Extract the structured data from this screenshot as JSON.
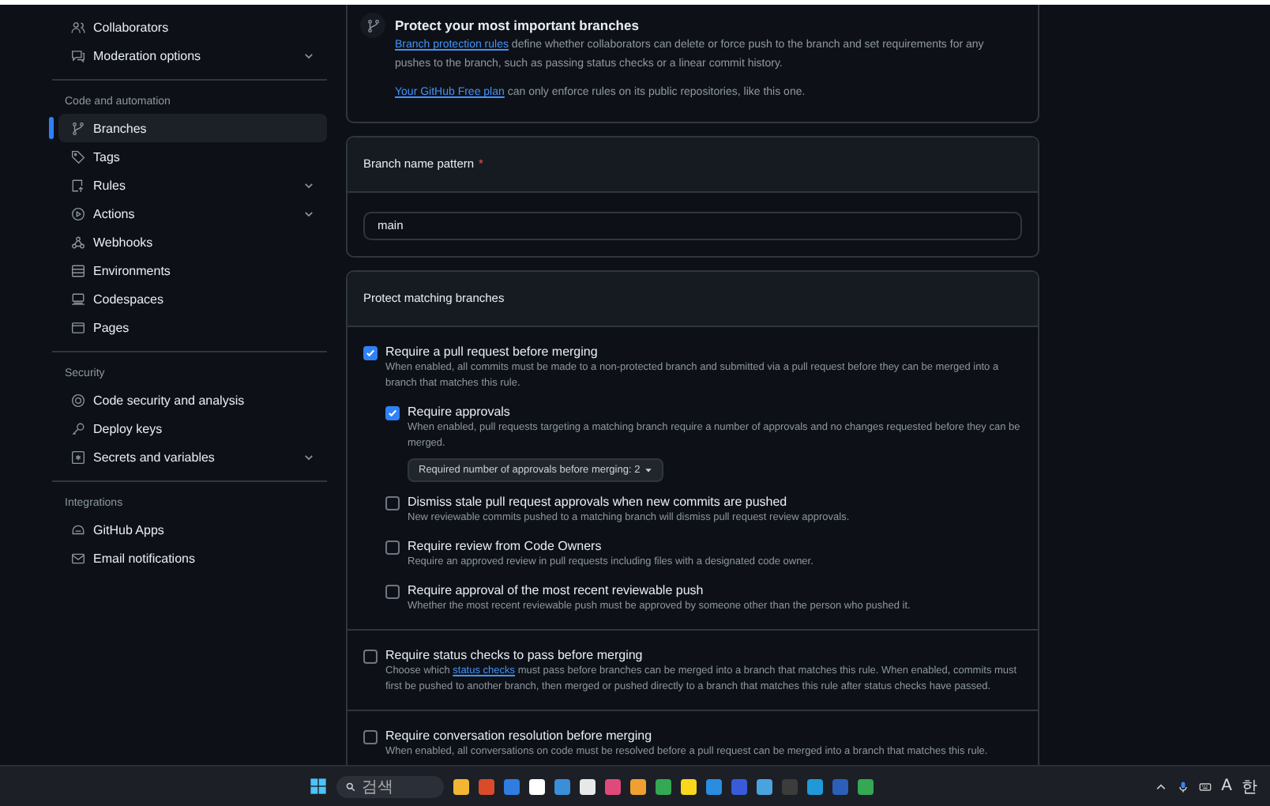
{
  "sidebar": {
    "groups": [
      {
        "items": [
          {
            "label": "Collaborators",
            "selected": false,
            "expandable": false
          },
          {
            "label": "Moderation options",
            "selected": false,
            "expandable": true
          }
        ]
      },
      {
        "heading": "Code and automation",
        "items": [
          {
            "label": "Branches",
            "selected": true,
            "expandable": false
          },
          {
            "label": "Tags",
            "selected": false,
            "expandable": false
          },
          {
            "label": "Rules",
            "selected": false,
            "expandable": true
          },
          {
            "label": "Actions",
            "selected": false,
            "expandable": true
          },
          {
            "label": "Webhooks",
            "selected": false,
            "expandable": false
          },
          {
            "label": "Environments",
            "selected": false,
            "expandable": false
          },
          {
            "label": "Codespaces",
            "selected": false,
            "expandable": false
          },
          {
            "label": "Pages",
            "selected": false,
            "expandable": false
          }
        ]
      },
      {
        "heading": "Security",
        "items": [
          {
            "label": "Code security and analysis",
            "selected": false,
            "expandable": false
          },
          {
            "label": "Deploy keys",
            "selected": false,
            "expandable": false
          },
          {
            "label": "Secrets and variables",
            "selected": false,
            "expandable": true
          }
        ]
      },
      {
        "heading": "Integrations",
        "items": [
          {
            "label": "GitHub Apps",
            "selected": false,
            "expandable": false
          },
          {
            "label": "Email notifications",
            "selected": false,
            "expandable": false
          }
        ]
      }
    ]
  },
  "intro": {
    "title": "Protect your most important branches",
    "paragraphs": [
      [
        {
          "kind": "link",
          "text": "Branch protection rules"
        },
        {
          "kind": "text",
          "text": " define whether collaborators can delete or force push to the branch and set requirements for any pushes to the branch, such as passing status checks or a linear commit history."
        }
      ],
      [
        {
          "kind": "link",
          "text": "Your GitHub Free plan"
        },
        {
          "kind": "text",
          "text": " can only enforce rules on its public repositories, like this one."
        }
      ]
    ]
  },
  "pattern": {
    "label": "Branch name pattern",
    "required_mark": "*",
    "value": "main"
  },
  "protect": {
    "heading": "Protect matching branches",
    "rules": [
      {
        "label": "Require a pull request before merging",
        "checked": true,
        "description": [
          {
            "kind": "text",
            "text": "When enabled, all commits must be made to a non-protected branch and submitted via a pull request before they can be merged into a branch that matches this rule."
          }
        ],
        "children": [
          {
            "label": "Require approvals",
            "checked": true,
            "description": [
              {
                "kind": "text",
                "text": "When enabled, pull requests targeting a matching branch require a number of approvals and no changes requested before they can be merged."
              }
            ],
            "dropdown": "Required number of approvals before merging: 2"
          },
          {
            "label": "Dismiss stale pull request approvals when new commits are pushed",
            "checked": false,
            "description": [
              {
                "kind": "text",
                "text": "New reviewable commits pushed to a matching branch will dismiss pull request review approvals."
              }
            ]
          },
          {
            "label": "Require review from Code Owners",
            "checked": false,
            "description": [
              {
                "kind": "text",
                "text": "Require an approved review in pull requests including files with a designated code owner."
              }
            ]
          },
          {
            "label": "Require approval of the most recent reviewable push",
            "checked": false,
            "description": [
              {
                "kind": "text",
                "text": "Whether the most recent reviewable push must be approved by someone other than the person who pushed it."
              }
            ]
          }
        ]
      },
      {
        "label": "Require status checks to pass before merging",
        "checked": false,
        "description": [
          {
            "kind": "text",
            "text": "Choose which "
          },
          {
            "kind": "link",
            "text": "status checks"
          },
          {
            "kind": "text",
            "text": " must pass before branches can be merged into a branch that matches this rule. When enabled, commits must first be pushed to another branch, then merged or pushed directly to a branch that matches this rule after status checks have passed."
          }
        ]
      },
      {
        "label": "Require conversation resolution before merging",
        "checked": false,
        "description": [
          {
            "kind": "text",
            "text": "When enabled, all conversations on code must be resolved before a pull request can be merged into a branch that matches this rule."
          }
        ]
      }
    ]
  },
  "taskbar": {
    "search_placeholder": "검색",
    "apps": [
      {
        "color": "#f2b632"
      },
      {
        "color": "#d94b2b"
      },
      {
        "color": "#2f7de1"
      },
      {
        "color": "#ffffff"
      },
      {
        "color": "#3b8ed8"
      },
      {
        "color": "#e8e8e8"
      },
      {
        "color": "#e04a7a"
      },
      {
        "color": "#f0a030"
      },
      {
        "color": "#34a853"
      },
      {
        "color": "#f9d71c"
      },
      {
        "color": "#2a8de0"
      },
      {
        "color": "#3a5bd9"
      },
      {
        "color": "#4aa3df"
      },
      {
        "color": "#3c3c3c"
      },
      {
        "color": "#1f9ad6"
      },
      {
        "color": "#2b5fb8"
      },
      {
        "color": "#34a853"
      }
    ],
    "tray": [
      "A",
      "한"
    ]
  }
}
